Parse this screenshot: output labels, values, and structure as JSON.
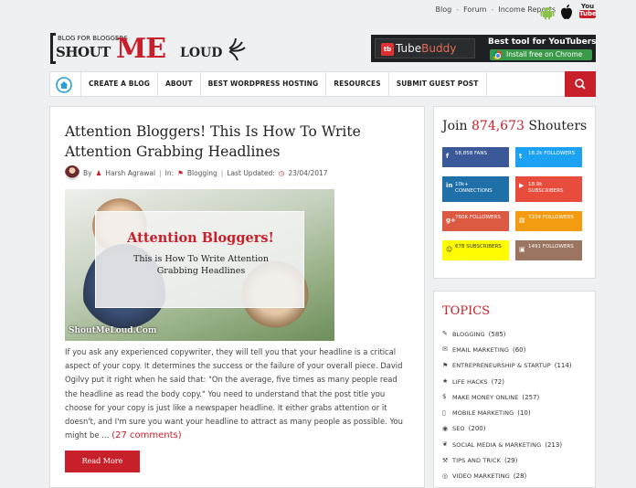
{
  "topbar": {
    "links": [
      "Blog",
      "Forum",
      "Income Reports"
    ],
    "separator": "-",
    "youtube_line1": "You",
    "youtube_line2": "Tube"
  },
  "brand": {
    "tagline": "BLOG FOR BLOGGERS",
    "shout": "SHOUT",
    "me": "ME",
    "loud": "LOUD"
  },
  "ad": {
    "logo": "tb",
    "name_a": "Tube",
    "name_b": "Buddy",
    "tagline": "Best tool for YouTubers",
    "cta": "Install free on Chrome"
  },
  "nav": {
    "items": [
      "CREATE A BLOG",
      "ABOUT",
      "BEST WORDPRESS HOSTING",
      "RESOURCES",
      "SUBMIT GUEST POST"
    ]
  },
  "post": {
    "title": "Attention Bloggers! This Is How To Write Attention Grabbing Headlines",
    "by": "By",
    "author": "Harsh Agrawal",
    "in": "In:",
    "category": "Blogging",
    "updated_label": "Last Updated:",
    "date": "23/04/2017",
    "image": {
      "heading": "Attention Bloggers!",
      "sub": "This is How To Write Attention Grabbing Headlines",
      "watermark": "ShoutMeLoud.Com"
    },
    "excerpt": "If you ask any experienced copywriter, they will tell you that your headline is a critical aspect of your copy. It determines the success or the failure of your overall piece. David Ogilvy put it right when he said that: \"On the average, five times as many people read the headline as read the body copy.\" You need to understand that the post title you choose for your copy is just like a newspaper headline. It either grabs attention or it doesn't, and I'm sure you want your headline to attract as many people as possible. You might be …",
    "comments": "(27 comments)",
    "read_more": "Read More"
  },
  "social": {
    "title_pre": "Join",
    "count": "874,673",
    "title_post": "Shouters",
    "buttons": [
      {
        "icon": "f",
        "count": "58,858",
        "label": "FANS",
        "color": "#3b5998"
      },
      {
        "icon": "t",
        "count": "18.2k",
        "label": "FOLLOWERS",
        "color": "#1da1f2"
      },
      {
        "icon": "in",
        "count": "10k+",
        "label": "CONNECTIONS",
        "color": "#1f6fa8"
      },
      {
        "icon": "▶",
        "count": "18.9k",
        "label": "SUBSCRIBERS",
        "color": "#e74c3c"
      },
      {
        "icon": "g+",
        "count": "760K",
        "label": "FOLLOWERS",
        "color": "#dd5a42"
      },
      {
        "icon": "▧",
        "count": "7224",
        "label": "FOLLOWERS",
        "color": "#f39c12"
      },
      {
        "icon": "☺",
        "count": "678",
        "label": "SUBSCRIBERS",
        "color": "#fffc00",
        "text_color": "#333"
      },
      {
        "icon": "▣",
        "count": "1491",
        "label": "FOLLOWERS",
        "color": "#9b7560"
      }
    ]
  },
  "topics": {
    "title": "TOPICS",
    "items": [
      {
        "icon": "✎",
        "label": "BLOGGING",
        "count": "(585)"
      },
      {
        "icon": "✉",
        "label": "EMAIL MARKETING",
        "count": "(60)"
      },
      {
        "icon": "⚑",
        "label": "ENTREPRENEURSHIP & STARTUP",
        "count": "(114)"
      },
      {
        "icon": "★",
        "label": "LIFE HACKS",
        "count": "(72)"
      },
      {
        "icon": "$",
        "label": "MAKE MONEY ONLINE",
        "count": "(257)"
      },
      {
        "icon": "▯",
        "label": "MOBILE MARKETING",
        "count": "(10)"
      },
      {
        "icon": "◉",
        "label": "SEO",
        "count": "(200)"
      },
      {
        "icon": "❦",
        "label": "SOCIAL MEDIA & MARKETING",
        "count": "(213)"
      },
      {
        "icon": "⚒",
        "label": "TIPS AND TRICK",
        "count": "(29)"
      },
      {
        "icon": "◎",
        "label": "VIDEO MARKETING",
        "count": "(28)"
      }
    ]
  },
  "colors": {
    "brand_red": "#c8202b",
    "background": "#eef0f1"
  }
}
